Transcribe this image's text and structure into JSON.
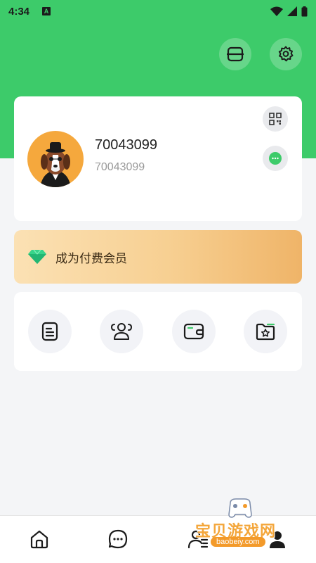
{
  "status_bar": {
    "time": "4:34",
    "notification_letter": "A"
  },
  "header": {
    "scan_icon": "scan-icon",
    "settings_icon": "gear-icon"
  },
  "profile": {
    "nickname": "70043099",
    "user_id": "70043099",
    "avatar_icon": "dog-avatar",
    "qr_icon": "qr-code-icon",
    "message_icon": "chat-bubble-icon"
  },
  "vip": {
    "label": "成为付费会员",
    "icon": "diamond-icon"
  },
  "tools": [
    {
      "icon": "document-icon"
    },
    {
      "icon": "users-icon"
    },
    {
      "icon": "wallet-icon"
    },
    {
      "icon": "favorite-folder-icon"
    }
  ],
  "bottom_nav": [
    {
      "icon": "home-icon"
    },
    {
      "icon": "message-icon"
    },
    {
      "icon": "contacts-icon"
    },
    {
      "icon": "profile-icon"
    }
  ],
  "watermark": {
    "title": "宝贝游戏网",
    "url": "baobeiy.com"
  },
  "colors": {
    "primary_green": "#3dcb6a",
    "vip_gold": "#efb468",
    "background": "#f4f5f7"
  }
}
